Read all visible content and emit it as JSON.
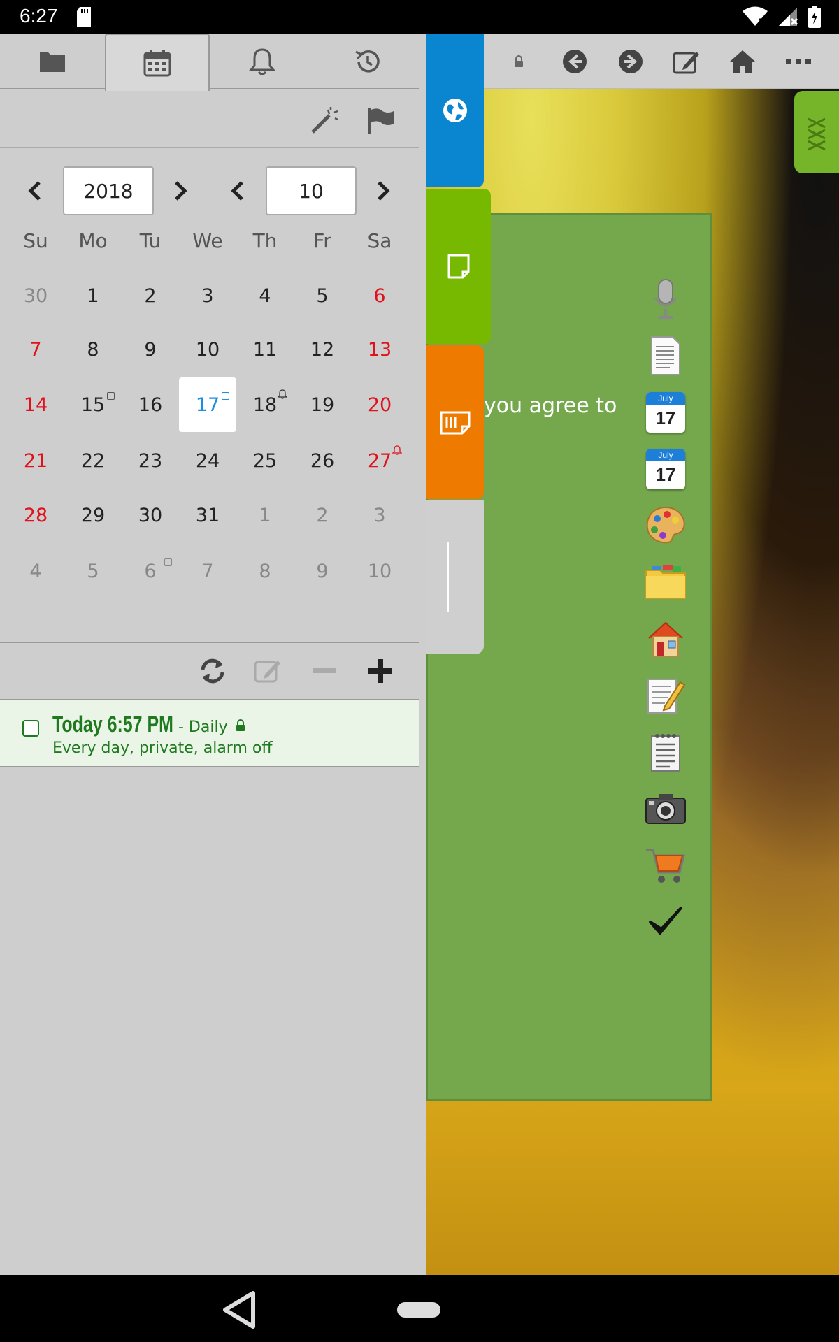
{
  "status_bar": {
    "time": "6:27"
  },
  "left_panel": {
    "tabs": [
      {
        "name": "folder-icon"
      },
      {
        "name": "calendar-icon",
        "active": true
      },
      {
        "name": "bell-icon"
      },
      {
        "name": "history-icon"
      }
    ],
    "year": "2018",
    "month": "10",
    "weekdays": [
      "Su",
      "Mo",
      "Tu",
      "We",
      "Th",
      "Fr",
      "Sa"
    ],
    "weeks": [
      [
        "30",
        "1",
        "2",
        "3",
        "4",
        "5",
        "6"
      ],
      [
        "7",
        "8",
        "9",
        "10",
        "11",
        "12",
        "13"
      ],
      [
        "14",
        "15",
        "16",
        "17",
        "18",
        "19",
        "20"
      ],
      [
        "21",
        "22",
        "23",
        "24",
        "25",
        "26",
        "27"
      ],
      [
        "28",
        "29",
        "30",
        "31",
        "1",
        "2",
        "3"
      ],
      [
        "4",
        "5",
        "6",
        "7",
        "8",
        "9",
        "10"
      ]
    ],
    "today": "17",
    "event": {
      "when": "Today  6:57 PM",
      "repeat": "- Daily",
      "details": "Every day, private, alarm off"
    }
  },
  "content": {
    "visible_text": "you agree to"
  },
  "colors": {
    "accent_blue": "#0a86d0",
    "accent_green": "#76b900",
    "accent_orange": "#ee7a00",
    "weekend_red": "#e0111b",
    "event_green": "#1f7a1f"
  }
}
